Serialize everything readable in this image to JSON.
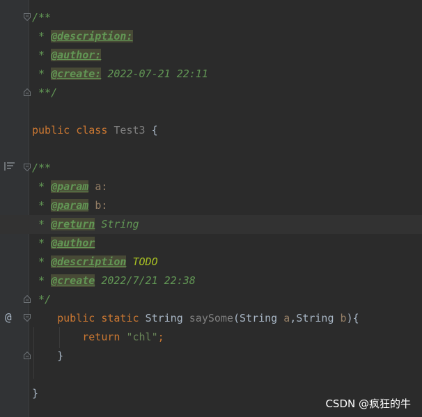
{
  "code": {
    "l1": "/**",
    "l2_star": " * ",
    "l2_tag": "@description:",
    "l3_star": " * ",
    "l3_tag": "@author:",
    "l4_star": " * ",
    "l4_tag": "@create:",
    "l4_val": " 2022-07-21 22:11",
    "l5": " **/",
    "l7_kw1": "public",
    "l7_kw2": "class",
    "l7_cls": "Test3",
    "l7_brace": "{",
    "l9": "/**",
    "l10_star": " * ",
    "l10_tag": "@param",
    "l10_name": "a:",
    "l11_star": " * ",
    "l11_tag": "@param",
    "l11_name": "b:",
    "l12_star": " * ",
    "l12_tag": "@return",
    "l12_val": " String",
    "l13_star": " * ",
    "l13_tag": "@author",
    "l14_star": " * ",
    "l14_tag": "@description",
    "l14_val": " TODO",
    "l15_star": " * ",
    "l15_tag": "@create",
    "l15_val": " 2022/7/21 22:38",
    "l16": " */",
    "l17_kw1": "public",
    "l17_kw2": "static",
    "l17_type": "String",
    "l17_name": "saySome",
    "l17_open": "(",
    "l17_t1": "String",
    "l17_p1": "a",
    "l17_comma": ",",
    "l17_t2": "String",
    "l17_p2": "b",
    "l17_close": "){",
    "l18_kw": "return",
    "l18_str": "\"chl\"",
    "l18_semi": ";",
    "l19": "}",
    "l21": "}"
  },
  "gutter": {
    "override_marker": "@"
  },
  "watermark": "CSDN @疯狂的牛"
}
